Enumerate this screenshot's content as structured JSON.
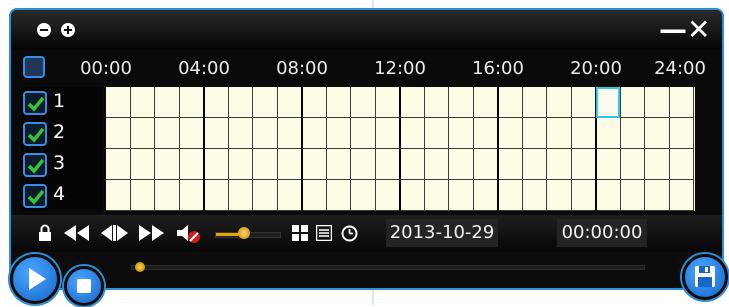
{
  "window": {
    "title_buttons": {
      "collapse": "minus-circle-icon",
      "expand": "plus-circle-icon"
    },
    "controls": {
      "minimize": "—",
      "close": "✕"
    }
  },
  "timeline": {
    "hours": [
      "00:00",
      "04:00",
      "08:00",
      "12:00",
      "16:00",
      "20:00",
      "24:00"
    ],
    "channels": [
      {
        "label": "1",
        "checked": true
      },
      {
        "label": "2",
        "checked": true
      },
      {
        "label": "3",
        "checked": true
      },
      {
        "label": "4",
        "checked": true
      }
    ],
    "selected_cell": {
      "channel": "1",
      "hour": 20
    }
  },
  "toolbar": {
    "date": "2013-10-29",
    "time": "00:00:00",
    "volume_level": 0.45,
    "icons": [
      "lock-icon",
      "rewind-icon",
      "frame-step-icon",
      "fast-forward-icon",
      "mute-icon",
      "grid-layout-icon",
      "list-icon",
      "clock-icon"
    ]
  },
  "playback": {
    "progress": 0.0,
    "buttons": {
      "play": "play-icon",
      "stop": "stop-icon",
      "save": "save-icon"
    }
  },
  "colors": {
    "accent": "#2e8fd6",
    "grid_bg": "#fbfbe6",
    "check": "#35c435",
    "selection": "#32c8e8"
  }
}
